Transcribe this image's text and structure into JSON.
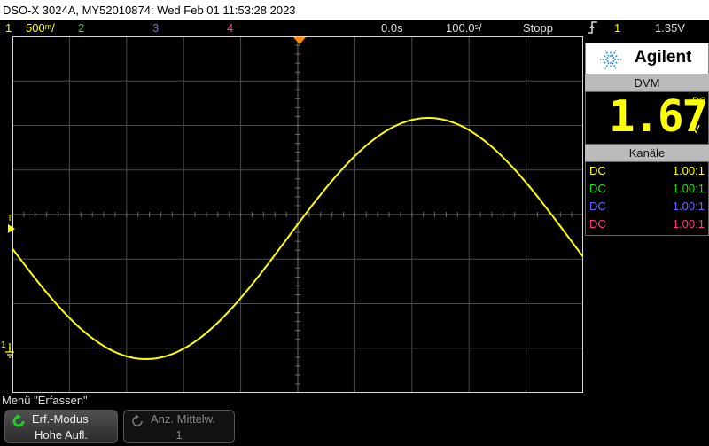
{
  "title_bar": "DSO-X 3024A, MY52010874: Wed Feb 01 11:53:28 2023",
  "status": {
    "ch1_num": "1",
    "ch1_scale": "500ᵐ/",
    "ch2_num": "2",
    "ch3_num": "3",
    "ch4_num": "4",
    "time_delay": "0.0s",
    "time_scale": "100.0ˢ/",
    "run_state": "Stopp",
    "trigger_ch": "1",
    "trigger_level": "1.35V"
  },
  "colors": {
    "ch1": "#ffff00",
    "ch2": "#22dd22",
    "ch3": "#6a6aff",
    "ch4": "#ff3d7f",
    "trigger_marker": "#ff8c00",
    "brand_logo": "#2288dd"
  },
  "graticule_markers": {
    "trigger_marker_label": "T",
    "ch1_ground_label": "1"
  },
  "brand": {
    "name": "Agilent",
    "logo_icon": "spark-logo-icon"
  },
  "dvm": {
    "header": "DVM",
    "value": "1.67",
    "mode": "DC",
    "unit": "V"
  },
  "channels_panel": {
    "header": "Kanäle",
    "rows": [
      {
        "coupling": "DC",
        "probe": "1.00:1"
      },
      {
        "coupling": "DC",
        "probe": "1.00:1"
      },
      {
        "coupling": "DC",
        "probe": "1.00:1"
      },
      {
        "coupling": "DC",
        "probe": "1.00:1"
      }
    ]
  },
  "menu": {
    "title": "Menü \"Erfassen\"",
    "softkeys": [
      {
        "line1": "Erf.-Modus",
        "line2": "Hohe Aufl.",
        "icon": "rotate-icon",
        "enabled": true
      },
      {
        "line1": "Anz. Mittelw.",
        "line2": "1",
        "icon": "rotate-icon",
        "enabled": false
      }
    ]
  },
  "waveform": {
    "channel": 1,
    "shape": "sine",
    "trigger_slope": "rising",
    "volts_per_div": 0.5,
    "seconds_per_div": 0.0001
  }
}
